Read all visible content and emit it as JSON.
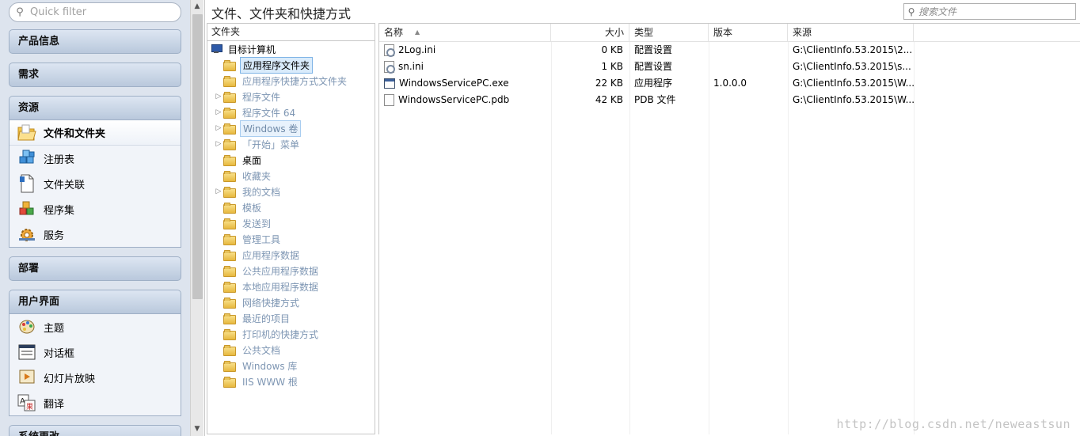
{
  "nav": {
    "quick_filter_placeholder": "Quick filter",
    "groups": [
      {
        "title": "产品信息"
      },
      {
        "title": "需求"
      },
      {
        "title": "资源",
        "items": [
          "文件和文件夹",
          "注册表",
          "文件关联",
          "程序集",
          "服务"
        ]
      },
      {
        "title": "部署"
      },
      {
        "title": "用户界面",
        "items": [
          "主题",
          "对话框",
          "幻灯片放映",
          "翻译"
        ]
      },
      {
        "title": "系统更改"
      }
    ]
  },
  "main": {
    "title": "文件、文件夹和快捷方式",
    "search_placeholder": "搜索文件"
  },
  "tree": {
    "header": "文件夹",
    "root": "目标计算机",
    "items": [
      {
        "label": "应用程序文件夹",
        "state": "selected",
        "expand": ""
      },
      {
        "label": "应用程序快捷方式文件夹",
        "state": "",
        "expand": ""
      },
      {
        "label": "程序文件",
        "state": "",
        "expand": "▷"
      },
      {
        "label": "程序文件 64",
        "state": "",
        "expand": "▷"
      },
      {
        "label": "Windows 卷",
        "state": "highlight",
        "expand": "▷"
      },
      {
        "label": "「开始」菜单",
        "state": "",
        "expand": "▷"
      },
      {
        "label": "桌面",
        "state": "dark",
        "expand": ""
      },
      {
        "label": "收藏夹",
        "state": "",
        "expand": ""
      },
      {
        "label": "我的文档",
        "state": "",
        "expand": "▷"
      },
      {
        "label": "模板",
        "state": "",
        "expand": ""
      },
      {
        "label": "发送到",
        "state": "",
        "expand": ""
      },
      {
        "label": "管理工具",
        "state": "",
        "expand": ""
      },
      {
        "label": "应用程序数据",
        "state": "",
        "expand": ""
      },
      {
        "label": "公共应用程序数据",
        "state": "",
        "expand": ""
      },
      {
        "label": "本地应用程序数据",
        "state": "",
        "expand": ""
      },
      {
        "label": "网络快捷方式",
        "state": "",
        "expand": ""
      },
      {
        "label": "最近的项目",
        "state": "",
        "expand": ""
      },
      {
        "label": "打印机的快捷方式",
        "state": "",
        "expand": ""
      },
      {
        "label": "公共文档",
        "state": "",
        "expand": ""
      },
      {
        "label": "Windows 库",
        "state": "",
        "expand": ""
      },
      {
        "label": "IIS WWW 根",
        "state": "",
        "expand": ""
      }
    ]
  },
  "files": {
    "columns": {
      "name": "名称",
      "size": "大小",
      "type": "类型",
      "version": "版本",
      "source": "来源"
    },
    "rows": [
      {
        "name": "2Log.ini",
        "icon": "ini-file-icon",
        "size": "0 KB",
        "type": "配置设置",
        "version": "",
        "source": "G:\\ClientInfo.53.2015\\2..."
      },
      {
        "name": "sn.ini",
        "icon": "ini-file-icon",
        "size": "1 KB",
        "type": "配置设置",
        "version": "",
        "source": "G:\\ClientInfo.53.2015\\s..."
      },
      {
        "name": "WindowsServicePC.exe",
        "icon": "exe-file-icon",
        "size": "22 KB",
        "type": "应用程序",
        "version": "1.0.0.0",
        "source": "G:\\ClientInfo.53.2015\\W..."
      },
      {
        "name": "WindowsServicePC.pdb",
        "icon": "pdb-file-icon",
        "size": "42 KB",
        "type": "PDB 文件",
        "version": "",
        "source": "G:\\ClientInfo.53.2015\\W..."
      }
    ]
  },
  "watermark": "http://blog.csdn.net/neweastsun"
}
